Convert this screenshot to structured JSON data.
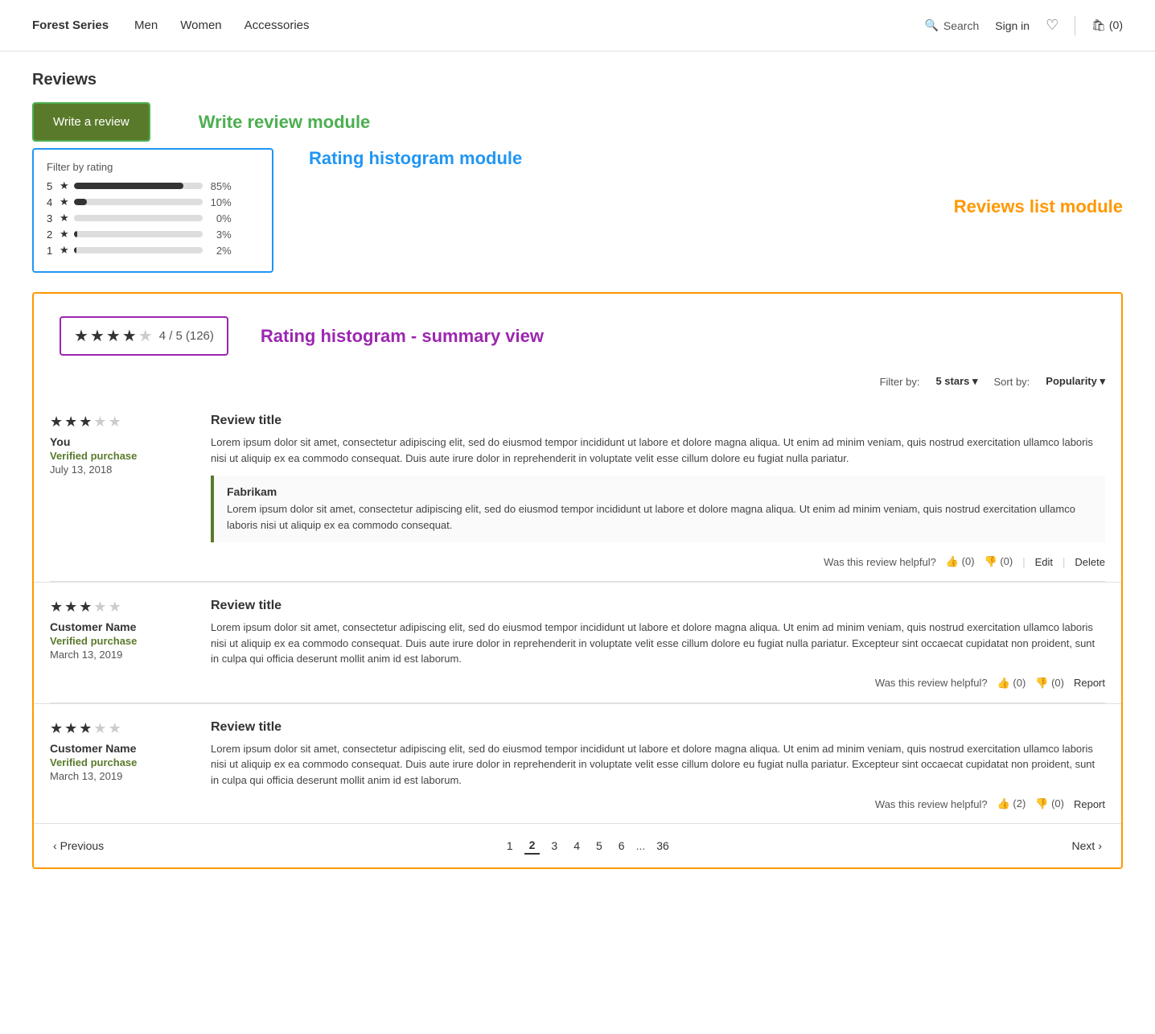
{
  "nav": {
    "brand": "Forest Series",
    "links": [
      "Men",
      "Women",
      "Accessories"
    ],
    "search_label": "Search",
    "signin_label": "Sign in",
    "cart_label": "(0)"
  },
  "page_title": "Reviews",
  "write_review_module_label": "Write review module",
  "write_review_btn": "Write a review",
  "rating_histogram_module_label": "Rating histogram module",
  "reviews_list_module_label": "Reviews list module",
  "histogram": {
    "title": "Filter by rating",
    "rows": [
      {
        "stars": 5,
        "pct": "85%",
        "fill_pct": 85
      },
      {
        "stars": 4,
        "pct": "10%",
        "fill_pct": 10
      },
      {
        "stars": 3,
        "pct": "0%",
        "fill_pct": 0
      },
      {
        "stars": 2,
        "pct": "3%",
        "fill_pct": 3
      },
      {
        "stars": 1,
        "pct": "2%",
        "fill_pct": 2
      }
    ]
  },
  "summary_view_label": "Rating histogram - summary view",
  "summary": {
    "score": "4 / 5",
    "count": "(126)",
    "filled": 4,
    "empty": 1
  },
  "filter_bar": {
    "filter_label": "Filter by:",
    "filter_value": "5 stars ▾",
    "sort_label": "Sort by:",
    "sort_value": "Popularity ▾"
  },
  "reviews": [
    {
      "stars_filled": 3,
      "stars_empty": 2,
      "reviewer": "You",
      "verified": "Verified purchase",
      "date": "July 13, 2018",
      "title": "Review title",
      "body": "Lorem ipsum dolor sit amet, consectetur adipiscing elit, sed do eiusmod tempor incididunt ut labore et dolore magna aliqua. Ut enim ad minim veniam, quis nostrud exercitation ullamco laboris nisi ut aliquip ex ea commodo consequat. Duis aute irure dolor in reprehenderit in voluptate velit esse cillum dolore eu fugiat nulla pariatur.",
      "helpful_text": "Was this review helpful?",
      "thumbs_up": "(0)",
      "thumbs_down": "(0)",
      "actions": [
        "Edit",
        "Delete"
      ],
      "response": {
        "name": "Fabrikam",
        "body": "Lorem ipsum dolor sit amet, consectetur adipiscing elit, sed do eiusmod tempor incididunt ut labore et dolore magna aliqua. Ut enim ad minim veniam, quis nostrud exercitation ullamco laboris nisi ut aliquip ex ea commodo consequat."
      }
    },
    {
      "stars_filled": 3,
      "stars_empty": 2,
      "reviewer": "Customer Name",
      "verified": "Verified purchase",
      "date": "March 13, 2019",
      "title": "Review title",
      "body": "Lorem ipsum dolor sit amet, consectetur adipiscing elit, sed do eiusmod tempor incididunt ut labore et dolore magna aliqua. Ut enim ad minim veniam, quis nostrud exercitation ullamco laboris nisi ut aliquip ex ea commodo consequat. Duis aute irure dolor in reprehenderit in voluptate velit esse cillum dolore eu fugiat nulla pariatur. Excepteur sint occaecat cupidatat non proident, sunt in culpa qui officia deserunt mollit anim id est laborum.",
      "helpful_text": "Was this review helpful?",
      "thumbs_up": "(0)",
      "thumbs_down": "(0)",
      "actions": [
        "Report"
      ],
      "response": null
    },
    {
      "stars_filled": 3,
      "stars_empty": 2,
      "reviewer": "Customer Name",
      "verified": "Verified purchase",
      "date": "March 13, 2019",
      "title": "Review title",
      "body": "Lorem ipsum dolor sit amet, consectetur adipiscing elit, sed do eiusmod tempor incididunt ut labore et dolore magna aliqua. Ut enim ad minim veniam, quis nostrud exercitation ullamco laboris nisi ut aliquip ex ea commodo consequat. Duis aute irure dolor in reprehenderit in voluptate velit esse cillum dolore eu fugiat nulla pariatur. Excepteur sint occaecat cupidatat non proident, sunt in culpa qui officia deserunt mollit anim id est laborum.",
      "helpful_text": "Was this review helpful?",
      "thumbs_up": "(2)",
      "thumbs_down": "(0)",
      "actions": [
        "Report"
      ],
      "response": null
    }
  ],
  "pagination": {
    "prev": "Previous",
    "next": "Next",
    "pages": [
      "1",
      "2",
      "3",
      "4",
      "5",
      "6",
      "...",
      "36"
    ],
    "active_page": "2"
  }
}
